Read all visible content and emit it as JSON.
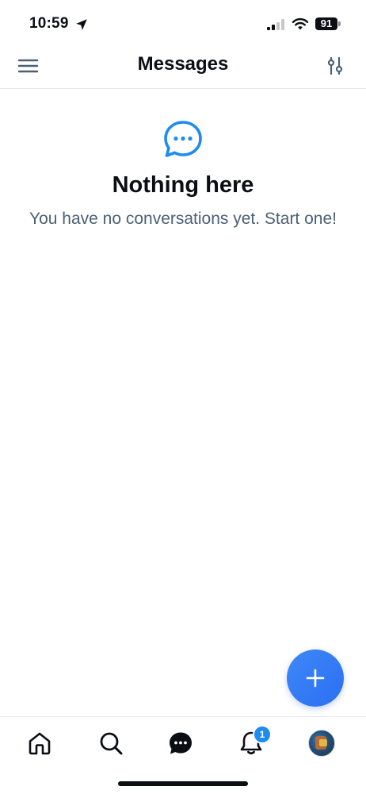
{
  "status_bar": {
    "time": "10:59",
    "battery_level": "91",
    "icons": [
      "location-arrow-icon",
      "cellular-signal-icon",
      "wifi-icon",
      "battery-icon"
    ]
  },
  "header": {
    "title": "Messages",
    "left_icon": "hamburger-menu-icon",
    "right_icon": "filter-settings-icon"
  },
  "empty_state": {
    "icon": "chat-bubble-icon",
    "title": "Nothing here",
    "subtitle": "You have no conversations yet. Start one!"
  },
  "fab": {
    "icon": "plus-icon"
  },
  "bottom_nav": {
    "items": [
      {
        "id": "home",
        "icon": "home-icon"
      },
      {
        "id": "search",
        "icon": "search-icon"
      },
      {
        "id": "messages",
        "icon": "chat-bubble-icon",
        "active": true
      },
      {
        "id": "notifications",
        "icon": "bell-icon",
        "badge": "1"
      },
      {
        "id": "profile",
        "icon": "avatar"
      }
    ]
  },
  "colors": {
    "accent": "#1d8cf0",
    "fab": "#2f78f4",
    "title_text": "#0b0f14",
    "subtitle_text": "#4b6075",
    "icon_gray": "#4b6075"
  }
}
